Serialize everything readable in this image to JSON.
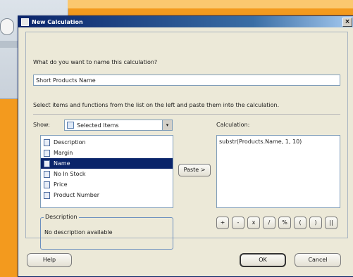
{
  "window": {
    "title": "New Calculation",
    "close_symbol": "×"
  },
  "name_section": {
    "prompt": "What do you want to name this calculation?",
    "value": "Short Products Name"
  },
  "instruction": "Select items and functions from the list on the left and paste them into the calculation.",
  "show": {
    "label": "Show:",
    "selected": "Selected Items",
    "arrow": "▾"
  },
  "items": [
    {
      "label": "Description",
      "selected": false
    },
    {
      "label": "Margin",
      "selected": false
    },
    {
      "label": "Name",
      "selected": true
    },
    {
      "label": "No In Stock",
      "selected": false
    },
    {
      "label": "Price",
      "selected": false
    },
    {
      "label": "Product Number",
      "selected": false
    }
  ],
  "paste_button": "Paste >",
  "calculation": {
    "label": "Calculation:",
    "text": "substr(Products.Name, 1, 10)"
  },
  "operators": [
    "+",
    "-",
    "x",
    "/",
    "%",
    "(",
    ")",
    "||"
  ],
  "description": {
    "legend": "Description",
    "text": "No description available"
  },
  "buttons": {
    "help": "Help",
    "ok": "OK",
    "cancel": "Cancel"
  }
}
